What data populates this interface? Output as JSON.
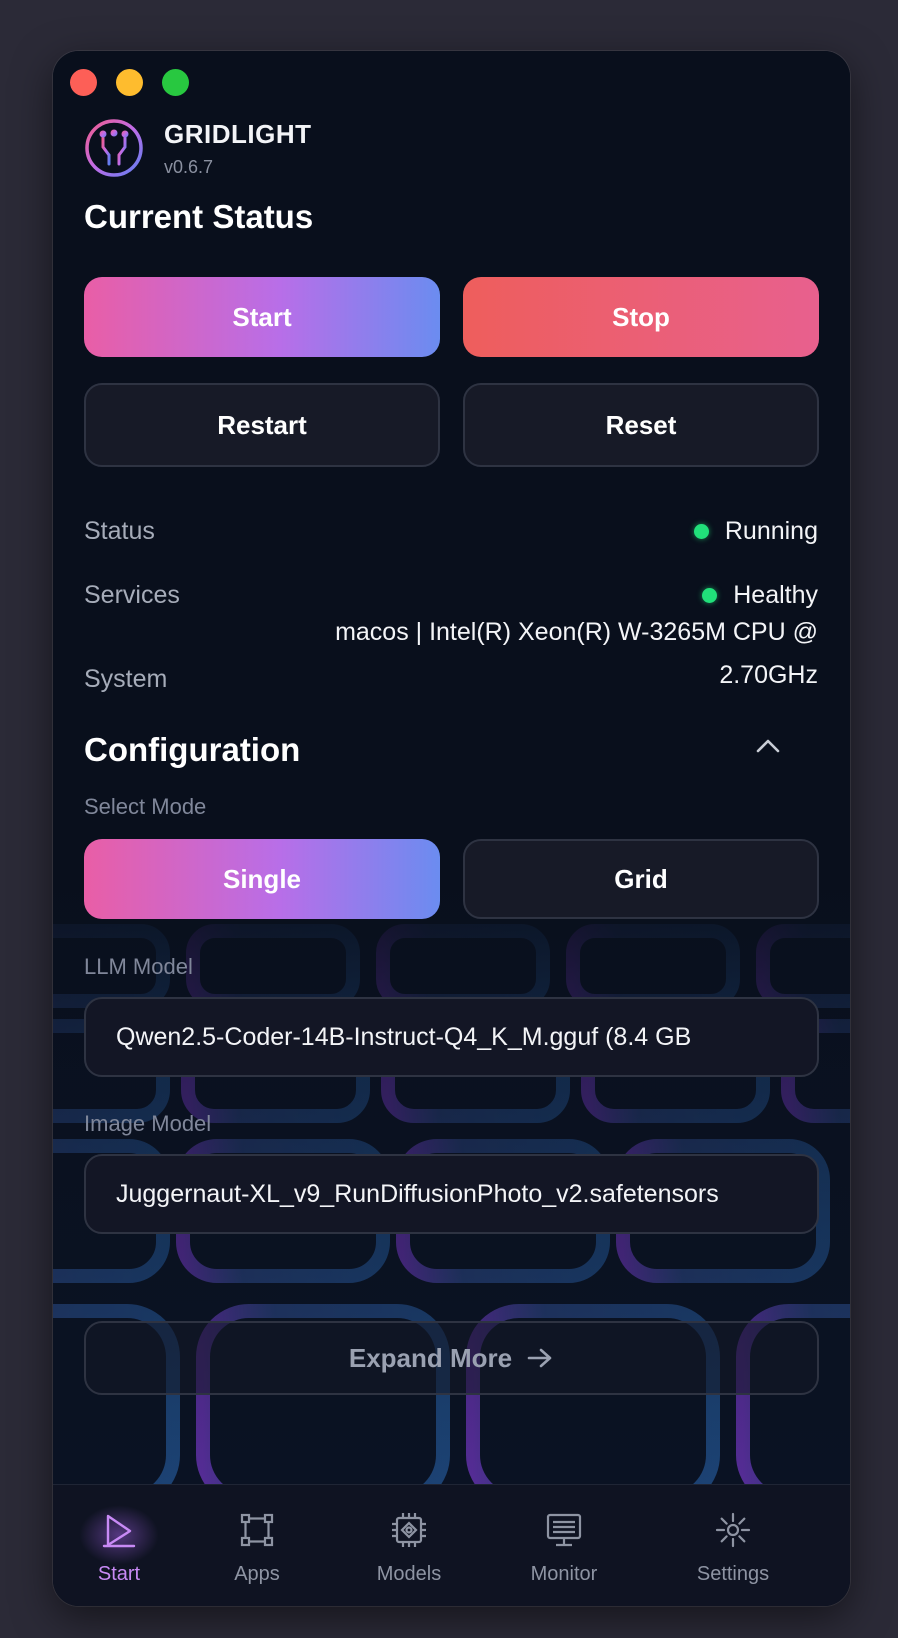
{
  "app": {
    "name": "GRIDLIGHT",
    "version": "v0.6.7"
  },
  "current_status": {
    "title": "Current Status",
    "buttons": {
      "start": "Start",
      "stop": "Stop",
      "restart": "Restart",
      "reset": "Reset"
    },
    "rows": {
      "status": {
        "label": "Status",
        "value": "Running",
        "color": "#21e07a"
      },
      "services": {
        "label": "Services",
        "value": "Healthy",
        "color": "#21e07a"
      },
      "system": {
        "label": "System",
        "value": "macos | Intel(R) Xeon(R) W-3265M CPU @ 2.70GHz"
      }
    }
  },
  "configuration": {
    "title": "Configuration",
    "select_mode_label": "Select Mode",
    "modes": {
      "single": "Single",
      "grid": "Grid",
      "selected": "Single"
    },
    "llm_model": {
      "label": "LLM Model",
      "value": "Qwen2.5-Coder-14B-Instruct-Q4_K_M.gguf (8.4 GB"
    },
    "image_model": {
      "label": "Image Model",
      "value": "Juggernaut-XL_v9_RunDiffusionPhoto_v2.safetensors"
    },
    "expand_label": "Expand More"
  },
  "tabs": [
    {
      "label": "Start",
      "icon": "start-icon",
      "active": true
    },
    {
      "label": "Apps",
      "icon": "apps-icon",
      "active": false
    },
    {
      "label": "Models",
      "icon": "models-icon",
      "active": false
    },
    {
      "label": "Monitor",
      "icon": "monitor-icon",
      "active": false
    },
    {
      "label": "Settings",
      "icon": "settings-icon",
      "active": false
    }
  ],
  "colors": {
    "accent_gradient": [
      "#e95ea6",
      "#b86ee8",
      "#6b8cf0"
    ],
    "stop_gradient": [
      "#ee5e5c",
      "#e8608e"
    ],
    "status_ok": "#21e07a",
    "active_tab": "#c88af5"
  }
}
